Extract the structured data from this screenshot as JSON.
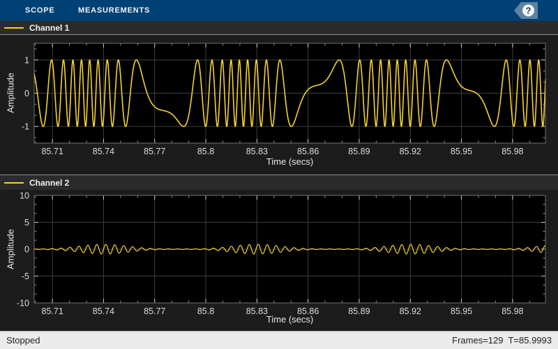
{
  "toolbar": {
    "background": "#004175",
    "tabs": [
      {
        "label": "SCOPE"
      },
      {
        "label": "MEASUREMENTS"
      }
    ],
    "help_label": "?"
  },
  "status_bar": {
    "left_text": "Stopped",
    "right_text": "Frames=129  T=85.9993",
    "background": "#ebebeb"
  },
  "colors": {
    "toolbar_blue": "#004175",
    "help_tag_blue": "#5e82a0",
    "line_yellow": "#f6d32f",
    "plot_background": "#000000",
    "grid": "#3f3f3f",
    "axes_box": "#707070",
    "tick_label": "#dcdcdc",
    "axis_label": "#e8e8e8",
    "legend_background": "#2b2b2b",
    "window_background": "#1c1c1c"
  },
  "chart_data": [
    {
      "type": "line",
      "legend": "Channel 1",
      "xlabel": "Time (secs)",
      "ylabel": "Amplitude",
      "xlim": [
        85.6993,
        85.9993
      ],
      "ylim": [
        -1.5,
        1.5
      ],
      "xticks": [
        85.71,
        85.74,
        85.77,
        85.8,
        85.83,
        85.86,
        85.89,
        85.92,
        85.95,
        85.98
      ],
      "xtick_labels": [
        "85.71",
        "85.74",
        "85.77",
        "85.8",
        "85.83",
        "85.86",
        "85.89",
        "85.92",
        "85.95",
        "85.98"
      ],
      "yticks": [
        1,
        0,
        -1
      ],
      "ytick_labels": [
        "1",
        "0",
        "-1"
      ],
      "grid": true,
      "legend_position": "top-strip",
      "series_color": "#f6d32f",
      "line_width": 1.6,
      "signal": {
        "kind": "fm_sine",
        "description": "Frequency-modulated sinusoid, amplitude ±1: fast ~200 Hz bursts alternating with slow troughs near -1, repeating every ~0.09 s",
        "amplitude": 1,
        "carrier_hz": 105,
        "freq_deviation_hz": 103,
        "mod_hz": 11.1111,
        "burst_center_t": 85.73,
        "phase": -0.865
      }
    },
    {
      "type": "line",
      "legend": "Channel 2",
      "xlabel": "Time (secs)",
      "ylabel": "Amplitude",
      "xlim": [
        85.6993,
        85.9993
      ],
      "ylim": [
        -10,
        10
      ],
      "xticks": [
        85.71,
        85.74,
        85.77,
        85.8,
        85.83,
        85.86,
        85.89,
        85.92,
        85.95,
        85.98
      ],
      "xtick_labels": [
        "85.71",
        "85.74",
        "85.77",
        "85.8",
        "85.83",
        "85.86",
        "85.89",
        "85.92",
        "85.95",
        "85.98"
      ],
      "yticks": [
        10,
        5,
        0,
        -5,
        -10
      ],
      "ytick_labels": [
        "10",
        "5",
        "0",
        "-5",
        "-10"
      ],
      "grid": true,
      "legend_position": "top-strip",
      "series_color": "#f6d32f",
      "line_width": 1.2,
      "signal": {
        "kind": "am_burst",
        "description": "Low-amplitude (~±0.9 on a ±10 scale) ~190 Hz ripple bursts synchronized with Channel 1 fast bursts, nearly flat between bursts",
        "carrier_hz": 190,
        "mod_hz": 11.1111,
        "burst_center_t": 85.74,
        "peak": 0.85,
        "base": 0.05,
        "env_pow": 2
      }
    }
  ]
}
